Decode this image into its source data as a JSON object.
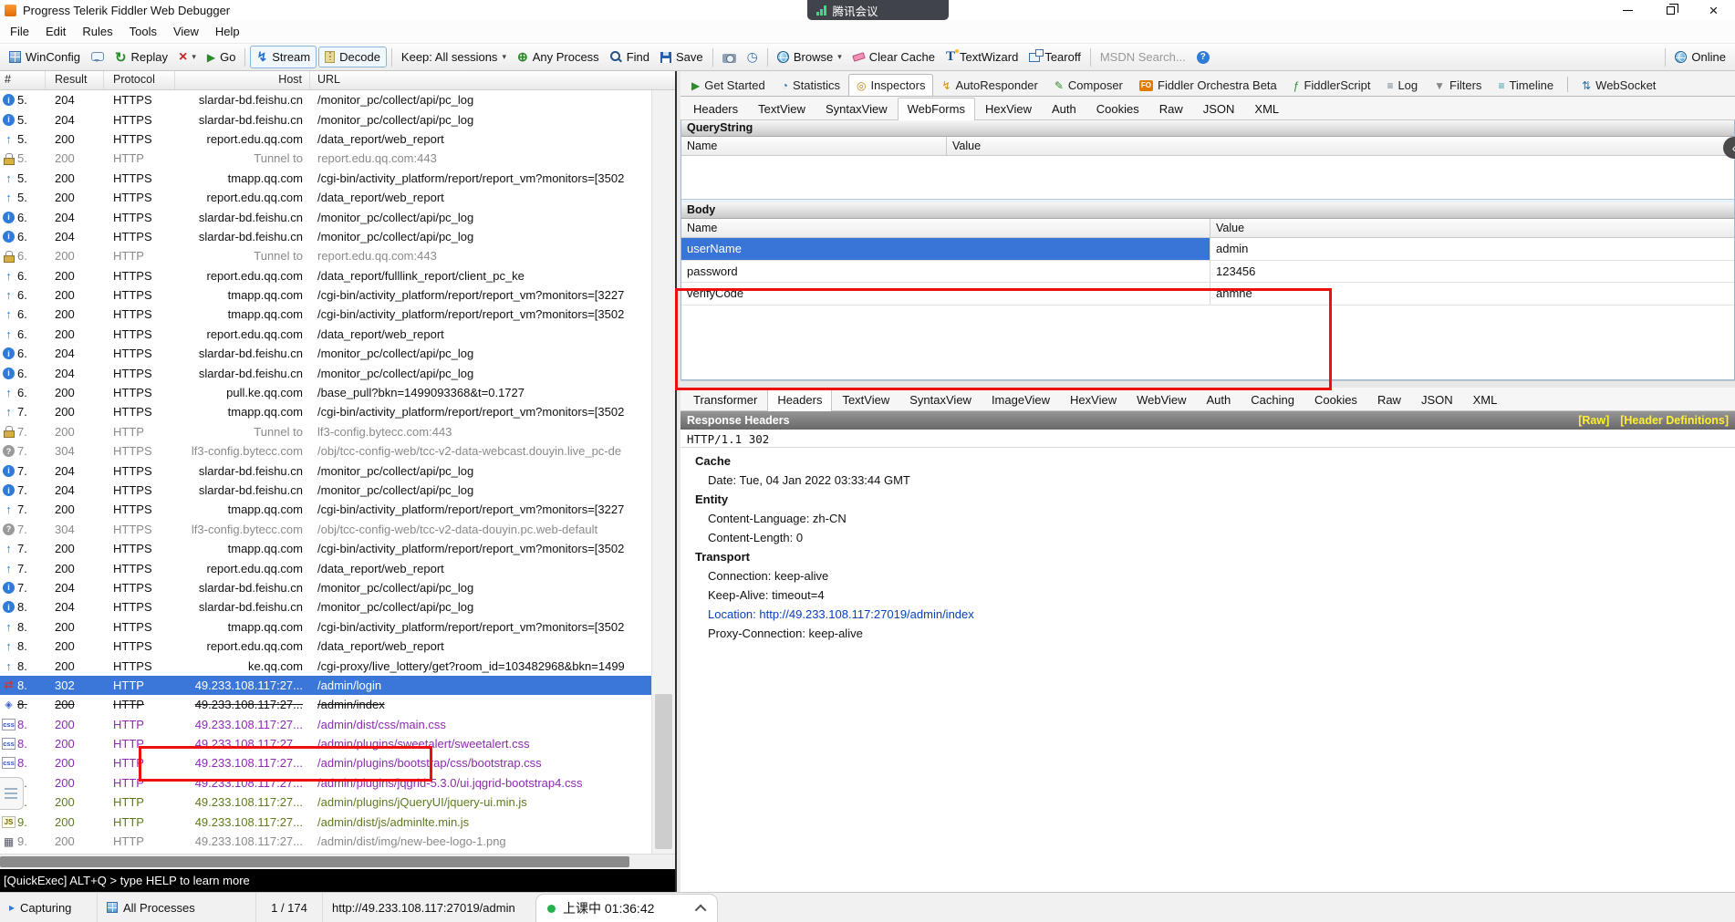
{
  "colors": {
    "selection": "#3a77d9",
    "annotation": "#ee0f0f",
    "link": "#0540c0",
    "css_row": "#8d2bb0",
    "js_row": "#5f7a1e",
    "muted_row": "#8a8a8a",
    "raw_link": "#ffee33"
  },
  "window": {
    "title": "Progress Telerik Fiddler Web Debugger"
  },
  "overlays": {
    "meeting_label": "腾讯会议",
    "timer_label": "上课中 01:36:42"
  },
  "menu": {
    "items": [
      "File",
      "Edit",
      "Rules",
      "Tools",
      "View",
      "Help"
    ]
  },
  "toolbar": {
    "winconfig": "WinConfig",
    "replay": "Replay",
    "go": "Go",
    "stream": "Stream",
    "decode": "Decode",
    "keep": "Keep: All sessions",
    "any_process": "Any Process",
    "find": "Find",
    "save": "Save",
    "browse": "Browse",
    "clear_cache": "Clear Cache",
    "textwizard": "TextWizard",
    "tearoff": "Tearoff",
    "msdn": "MSDN Search...",
    "online": "Online"
  },
  "session_list": {
    "columns": [
      "#",
      "Result",
      "Protocol",
      "Host",
      "URL"
    ],
    "rows": [
      {
        "icon": "info",
        "num": "5.",
        "result": "204",
        "protocol": "HTTPS",
        "host": "slardar-bd.feishu.cn",
        "url": "/monitor_pc/collect/api/pc_log",
        "style": "normal"
      },
      {
        "icon": "info",
        "num": "5.",
        "result": "204",
        "protocol": "HTTPS",
        "host": "slardar-bd.feishu.cn",
        "url": "/monitor_pc/collect/api/pc_log",
        "style": "normal"
      },
      {
        "icon": "up",
        "num": "5.",
        "result": "200",
        "protocol": "HTTPS",
        "host": "report.edu.qq.com",
        "url": "/data_report/web_report",
        "style": "normal"
      },
      {
        "icon": "lock",
        "num": "5.",
        "result": "200",
        "protocol": "HTTP",
        "host": "Tunnel to",
        "url": "report.edu.qq.com:443",
        "style": "muted"
      },
      {
        "icon": "up",
        "num": "5.",
        "result": "200",
        "protocol": "HTTPS",
        "host": "tmapp.qq.com",
        "url": "/cgi-bin/activity_platform/report/report_vm?monitors=[3502",
        "style": "normal"
      },
      {
        "icon": "up",
        "num": "5.",
        "result": "200",
        "protocol": "HTTPS",
        "host": "report.edu.qq.com",
        "url": "/data_report/web_report",
        "style": "normal"
      },
      {
        "icon": "info",
        "num": "6.",
        "result": "204",
        "protocol": "HTTPS",
        "host": "slardar-bd.feishu.cn",
        "url": "/monitor_pc/collect/api/pc_log",
        "style": "normal"
      },
      {
        "icon": "info",
        "num": "6.",
        "result": "204",
        "protocol": "HTTPS",
        "host": "slardar-bd.feishu.cn",
        "url": "/monitor_pc/collect/api/pc_log",
        "style": "normal"
      },
      {
        "icon": "lock",
        "num": "6.",
        "result": "200",
        "protocol": "HTTP",
        "host": "Tunnel to",
        "url": "report.edu.qq.com:443",
        "style": "muted"
      },
      {
        "icon": "up",
        "num": "6.",
        "result": "200",
        "protocol": "HTTPS",
        "host": "report.edu.qq.com",
        "url": "/data_report/fulllink_report/client_pc_ke",
        "style": "normal"
      },
      {
        "icon": "up",
        "num": "6.",
        "result": "200",
        "protocol": "HTTPS",
        "host": "tmapp.qq.com",
        "url": "/cgi-bin/activity_platform/report/report_vm?monitors=[3227",
        "style": "normal"
      },
      {
        "icon": "up",
        "num": "6.",
        "result": "200",
        "protocol": "HTTPS",
        "host": "tmapp.qq.com",
        "url": "/cgi-bin/activity_platform/report/report_vm?monitors=[3502",
        "style": "normal"
      },
      {
        "icon": "up",
        "num": "6.",
        "result": "200",
        "protocol": "HTTPS",
        "host": "report.edu.qq.com",
        "url": "/data_report/web_report",
        "style": "normal"
      },
      {
        "icon": "info",
        "num": "6.",
        "result": "204",
        "protocol": "HTTPS",
        "host": "slardar-bd.feishu.cn",
        "url": "/monitor_pc/collect/api/pc_log",
        "style": "normal"
      },
      {
        "icon": "info",
        "num": "6.",
        "result": "204",
        "protocol": "HTTPS",
        "host": "slardar-bd.feishu.cn",
        "url": "/monitor_pc/collect/api/pc_log",
        "style": "normal"
      },
      {
        "icon": "up",
        "num": "6.",
        "result": "200",
        "protocol": "HTTPS",
        "host": "pull.ke.qq.com",
        "url": "/base_pull?bkn=1499093368&t=0.1727",
        "style": "normal"
      },
      {
        "icon": "up",
        "num": "7.",
        "result": "200",
        "protocol": "HTTPS",
        "host": "tmapp.qq.com",
        "url": "/cgi-bin/activity_platform/report/report_vm?monitors=[3502",
        "style": "normal"
      },
      {
        "icon": "lock",
        "num": "7.",
        "result": "200",
        "protocol": "HTTP",
        "host": "Tunnel to",
        "url": "lf3-config.bytecc.com:443",
        "style": "muted"
      },
      {
        "icon": "q",
        "num": "7.",
        "result": "304",
        "protocol": "HTTPS",
        "host": "lf3-config.bytecc.com",
        "url": "/obj/tcc-config-web/tcc-v2-data-webcast.douyin.live_pc-de",
        "style": "muted"
      },
      {
        "icon": "info",
        "num": "7.",
        "result": "204",
        "protocol": "HTTPS",
        "host": "slardar-bd.feishu.cn",
        "url": "/monitor_pc/collect/api/pc_log",
        "style": "normal"
      },
      {
        "icon": "info",
        "num": "7.",
        "result": "204",
        "protocol": "HTTPS",
        "host": "slardar-bd.feishu.cn",
        "url": "/monitor_pc/collect/api/pc_log",
        "style": "normal"
      },
      {
        "icon": "up",
        "num": "7.",
        "result": "200",
        "protocol": "HTTPS",
        "host": "tmapp.qq.com",
        "url": "/cgi-bin/activity_platform/report/report_vm?monitors=[3227",
        "style": "normal"
      },
      {
        "icon": "q",
        "num": "7.",
        "result": "304",
        "protocol": "HTTPS",
        "host": "lf3-config.bytecc.com",
        "url": "/obj/tcc-config-web/tcc-v2-data-douyin.pc.web-default",
        "style": "muted"
      },
      {
        "icon": "up",
        "num": "7.",
        "result": "200",
        "protocol": "HTTPS",
        "host": "tmapp.qq.com",
        "url": "/cgi-bin/activity_platform/report/report_vm?monitors=[3502",
        "style": "normal"
      },
      {
        "icon": "up",
        "num": "7.",
        "result": "200",
        "protocol": "HTTPS",
        "host": "report.edu.qq.com",
        "url": "/data_report/web_report",
        "style": "normal"
      },
      {
        "icon": "info",
        "num": "7.",
        "result": "204",
        "protocol": "HTTPS",
        "host": "slardar-bd.feishu.cn",
        "url": "/monitor_pc/collect/api/pc_log",
        "style": "normal"
      },
      {
        "icon": "info",
        "num": "8.",
        "result": "204",
        "protocol": "HTTPS",
        "host": "slardar-bd.feishu.cn",
        "url": "/monitor_pc/collect/api/pc_log",
        "style": "normal"
      },
      {
        "icon": "up",
        "num": "8.",
        "result": "200",
        "protocol": "HTTPS",
        "host": "tmapp.qq.com",
        "url": "/cgi-bin/activity_platform/report/report_vm?monitors=[3502",
        "style": "normal"
      },
      {
        "icon": "up",
        "num": "8.",
        "result": "200",
        "protocol": "HTTPS",
        "host": "report.edu.qq.com",
        "url": "/data_report/web_report",
        "style": "normal"
      },
      {
        "icon": "up",
        "num": "8.",
        "result": "200",
        "protocol": "HTTPS",
        "host": "ke.qq.com",
        "url": "/cgi-proxy/live_lottery/get?room_id=103482968&bkn=1499",
        "style": "normal"
      },
      {
        "icon": "redirect",
        "num": "8.",
        "result": "302",
        "protocol": "HTTP",
        "host": "49.233.108.117:27...",
        "url": "/admin/login",
        "style": "selected"
      },
      {
        "icon": "nav",
        "num": "8.",
        "result": "200",
        "protocol": "HTTP",
        "host": "49.233.108.117:27...",
        "url": "/admin/index",
        "style": "strike"
      },
      {
        "icon": "css",
        "num": "8.",
        "result": "200",
        "protocol": "HTTP",
        "host": "49.233.108.117:27...",
        "url": "/admin/dist/css/main.css",
        "style": "css"
      },
      {
        "icon": "css",
        "num": "8.",
        "result": "200",
        "protocol": "HTTP",
        "host": "49.233.108.117:27...",
        "url": "/admin/plugins/sweetalert/sweetalert.css",
        "style": "css"
      },
      {
        "icon": "css",
        "num": "8.",
        "result": "200",
        "protocol": "HTTP",
        "host": "49.233.108.117:27...",
        "url": "/admin/plugins/bootstrap/css/bootstrap.css",
        "style": "css"
      },
      {
        "icon": "css",
        "num": "8.",
        "result": "200",
        "protocol": "HTTP",
        "host": "49.233.108.117:27...",
        "url": "/admin/plugins/jqgrid-5.3.0/ui.jqgrid-bootstrap4.css",
        "style": "css"
      },
      {
        "icon": "js",
        "num": "8.",
        "result": "200",
        "protocol": "HTTP",
        "host": "49.233.108.117:27...",
        "url": "/admin/plugins/jQueryUI/jquery-ui.min.js",
        "style": "js"
      },
      {
        "icon": "js",
        "num": "9.",
        "result": "200",
        "protocol": "HTTP",
        "host": "49.233.108.117:27...",
        "url": "/admin/dist/js/adminlte.min.js",
        "style": "js"
      },
      {
        "icon": "img",
        "num": "9.",
        "result": "200",
        "protocol": "HTTP",
        "host": "49.233.108.117:27...",
        "url": "/admin/dist/img/new-bee-logo-1.png",
        "style": "muted"
      }
    ]
  },
  "main_tabs": {
    "active": "Inspectors",
    "items": [
      {
        "label": "Get Started",
        "icon": "play-icon"
      },
      {
        "label": "Statistics",
        "icon": "statistics-icon"
      },
      {
        "label": "Inspectors",
        "icon": "inspectors-icon"
      },
      {
        "label": "AutoResponder",
        "icon": "lightning-icon"
      },
      {
        "label": "Composer",
        "icon": "composer-icon"
      },
      {
        "label": "Fiddler Orchestra Beta",
        "icon": "orchestra-icon"
      },
      {
        "label": "FiddlerScript",
        "icon": "script-icon"
      },
      {
        "label": "Log",
        "icon": "log-icon"
      },
      {
        "label": "Filters",
        "icon": "filters-icon"
      },
      {
        "label": "Timeline",
        "icon": "timeline-icon"
      },
      {
        "label": "WebSocket",
        "icon": "websocket-icon"
      }
    ]
  },
  "request_tabs": {
    "active": "WebForms",
    "items": [
      "Headers",
      "TextView",
      "SyntaxView",
      "WebForms",
      "HexView",
      "Auth",
      "Cookies",
      "Raw",
      "JSON",
      "XML"
    ]
  },
  "querystring": {
    "title": "QueryString",
    "columns": [
      "Name",
      "Value"
    ],
    "rows": []
  },
  "body": {
    "title": "Body",
    "columns": [
      "Name",
      "Value"
    ],
    "rows": [
      {
        "name": "userName",
        "value": "admin",
        "selected": true
      },
      {
        "name": "password",
        "value": "123456",
        "selected": false
      },
      {
        "name": "verifyCode",
        "value": "anmne",
        "selected": false
      }
    ]
  },
  "response_tabs": {
    "active": "Headers",
    "items": [
      "Transformer",
      "Headers",
      "TextView",
      "SyntaxView",
      "ImageView",
      "HexView",
      "WebView",
      "Auth",
      "Caching",
      "Cookies",
      "Raw",
      "JSON",
      "XML"
    ]
  },
  "response_headers": {
    "title": "Response Headers",
    "links": [
      "[Raw]",
      "[Header Definitions]"
    ],
    "status_line": "HTTP/1.1 302",
    "groups": [
      {
        "name": "Cache",
        "items": [
          {
            "text": "Date: Tue, 04 Jan 2022 03:33:44 GMT",
            "link": false
          }
        ]
      },
      {
        "name": "Entity",
        "items": [
          {
            "text": "Content-Language: zh-CN",
            "link": false
          },
          {
            "text": "Content-Length: 0",
            "link": false
          }
        ]
      },
      {
        "name": "Transport",
        "items": [
          {
            "text": "Connection: keep-alive",
            "link": false
          },
          {
            "text": "Keep-Alive: timeout=4",
            "link": false
          },
          {
            "text": "Location: http://49.233.108.117:27019/admin/index",
            "link": true
          },
          {
            "text": "Proxy-Connection: keep-alive",
            "link": false
          }
        ]
      }
    ]
  },
  "quickexec": {
    "text": "[QuickExec] ALT+Q > type HELP to learn more"
  },
  "statusbar": {
    "capturing": "Capturing",
    "processes": "All Processes",
    "count": "1 / 174",
    "url": "http://49.233.108.117:27019/admin"
  }
}
